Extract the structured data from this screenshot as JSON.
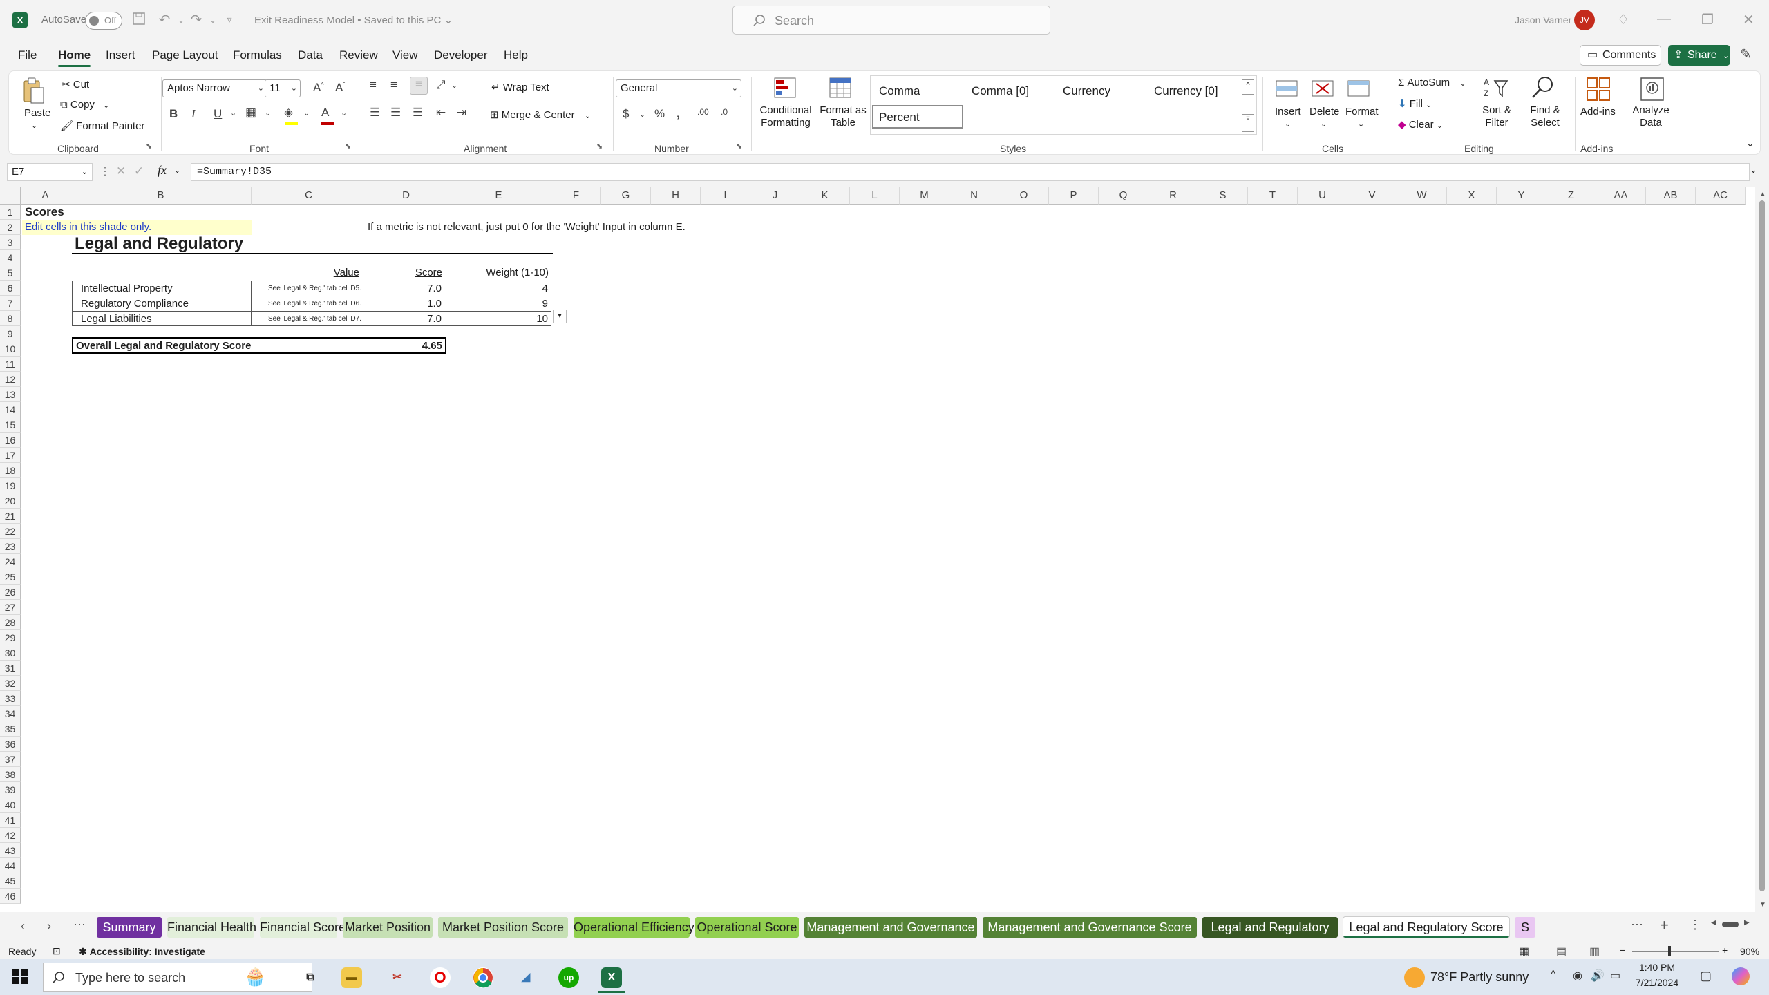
{
  "titlebar": {
    "app_icon": "excel-icon",
    "autosave_label": "AutoSave",
    "autosave_state": "Off",
    "document_title": "Exit Readiness Model • Saved to this PC",
    "search_placeholder": "Search",
    "user_name": "Jason Varner",
    "user_initials": "JV"
  },
  "menu": {
    "tabs": [
      "File",
      "Home",
      "Insert",
      "Page Layout",
      "Formulas",
      "Data",
      "Review",
      "View",
      "Developer",
      "Help"
    ],
    "active": "Home",
    "comments_label": "Comments",
    "share_label": "Share"
  },
  "ribbon": {
    "clipboard": {
      "paste": "Paste",
      "cut": "Cut",
      "copy": "Copy",
      "format_painter": "Format Painter",
      "group": "Clipboard"
    },
    "font": {
      "name": "Aptos Narrow",
      "size": "11",
      "group": "Font"
    },
    "alignment": {
      "wrap_text": "Wrap Text",
      "merge_center": "Merge & Center",
      "group": "Alignment"
    },
    "number": {
      "format": "General",
      "group": "Number"
    },
    "styles": {
      "conditional_formatting": "Conditional Formatting",
      "format_as_table": "Format as Table",
      "cells": [
        "Comma",
        "Comma [0]",
        "Currency",
        "Currency [0]",
        "Percent"
      ],
      "group": "Styles"
    },
    "cells": {
      "insert": "Insert",
      "delete": "Delete",
      "format": "Format",
      "group": "Cells"
    },
    "editing": {
      "autosum": "AutoSum",
      "fill": "Fill",
      "clear": "Clear",
      "sort_filter": "Sort & Filter",
      "find_select": "Find & Select",
      "group": "Editing"
    },
    "addins": {
      "addins": "Add-ins",
      "analyze": "Analyze Data",
      "group": "Add-ins"
    }
  },
  "formula_bar": {
    "name_box": "E7",
    "formula": "=Summary!D35"
  },
  "grid": {
    "columns": [
      "A",
      "B",
      "C",
      "D",
      "E",
      "F",
      "G",
      "H",
      "I",
      "J",
      "K",
      "L",
      "M",
      "N",
      "O",
      "P",
      "Q",
      "R",
      "S",
      "T",
      "U",
      "V",
      "W",
      "X",
      "Y",
      "Z",
      "AA",
      "AB",
      "AC"
    ],
    "rows": [
      "1",
      "2",
      "3",
      "4",
      "5",
      "6",
      "7",
      "8",
      "9",
      "10",
      "11",
      "12",
      "13",
      "14",
      "15",
      "16",
      "17",
      "18",
      "19",
      "20",
      "21",
      "22",
      "23",
      "24",
      "25",
      "26",
      "27",
      "28",
      "29",
      "30",
      "31",
      "32",
      "33",
      "34",
      "35",
      "36",
      "37",
      "38",
      "39",
      "40",
      "41",
      "42",
      "43",
      "44",
      "45",
      "46"
    ],
    "a1": "Scores",
    "a2": "Edit cells in this shade only.",
    "note": "If a metric is not relevant, just put 0 for the 'Weight' Input in column E.",
    "section_title": "Legal and Regulatory",
    "headers": {
      "value": "Value",
      "score": "Score",
      "weight": "Weight (1-10)"
    },
    "metrics": [
      {
        "name": "Intellectual Property",
        "value": "See 'Legal & Reg.' tab cell D5.",
        "score": "7.0",
        "weight": "4"
      },
      {
        "name": "Regulatory Compliance",
        "value": "See 'Legal & Reg.' tab cell D6.",
        "score": "1.0",
        "weight": "9"
      },
      {
        "name": "Legal Liabilities",
        "value": "See 'Legal & Reg.' tab cell D7.",
        "score": "7.0",
        "weight": "10"
      }
    ],
    "overall_label": "Overall Legal and Regulatory Score",
    "overall_value": "4.65"
  },
  "sheet_tabs": [
    {
      "label": "Summary",
      "bg": "#7030a0",
      "fg": "#ffffff"
    },
    {
      "label": "Financial Health",
      "bg": "#e2efda",
      "fg": "#1f1f1f"
    },
    {
      "label": "Financial Score",
      "bg": "#e2efda",
      "fg": "#1f1f1f"
    },
    {
      "label": "Market Position",
      "bg": "#c6e0b4",
      "fg": "#1f1f1f"
    },
    {
      "label": "Market Position Score",
      "bg": "#c6e0b4",
      "fg": "#1f1f1f"
    },
    {
      "label": "Operational Efficiency",
      "bg": "#92d050",
      "fg": "#1f1f1f"
    },
    {
      "label": "Operational Score",
      "bg": "#92d050",
      "fg": "#1f1f1f"
    },
    {
      "label": "Management and Governance",
      "bg": "#548235",
      "fg": "#ffffff"
    },
    {
      "label": "Management and Governance Score",
      "bg": "#548235",
      "fg": "#ffffff"
    },
    {
      "label": "Legal and Regulatory",
      "bg": "#375623",
      "fg": "#ffffff"
    },
    {
      "label": "Legal and Regulatory Score",
      "bg": "#ffffff",
      "fg": "#1f1f1f"
    },
    {
      "label": "S",
      "bg": "#e9c7f2",
      "fg": "#1f1f1f"
    }
  ],
  "status": {
    "ready": "Ready",
    "accessibility": "Accessibility: Investigate",
    "zoom": "90%"
  },
  "taskbar": {
    "search_placeholder": "Type here to search",
    "weather": "78°F  Partly sunny",
    "time": "1:40 PM",
    "date": "7/21/2024"
  }
}
